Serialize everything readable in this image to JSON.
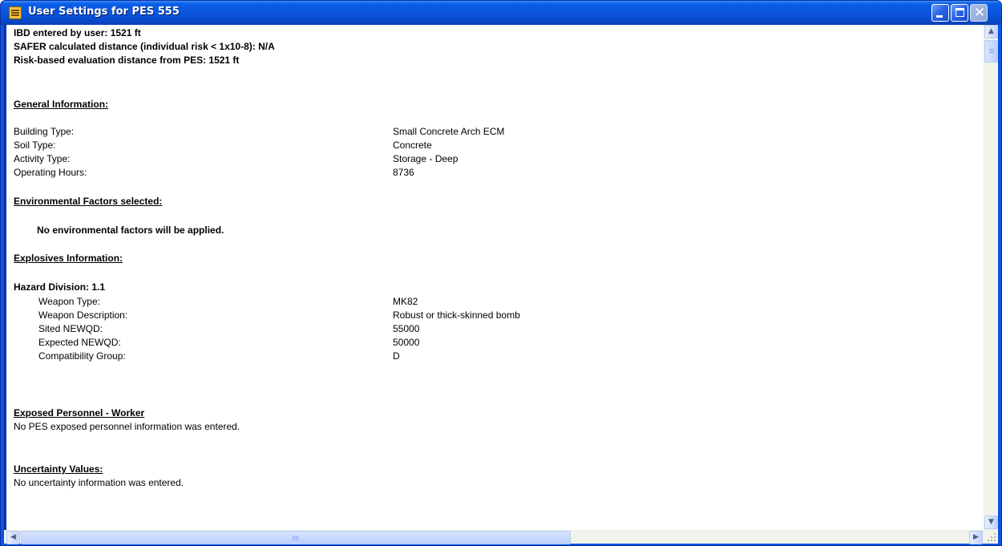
{
  "window": {
    "title": "User Settings for PES 555",
    "icons": {
      "app": "document-list-icon",
      "minimize": "minimize-icon",
      "maximize": "maximize-icon",
      "close": "close-icon"
    }
  },
  "summary": {
    "ibd": "IBD entered by user: 1521 ft",
    "safer": "SAFER calculated distance (individual risk < 1x10-8): N/A",
    "risk": "Risk-based evaluation distance from PES: 1521 ft"
  },
  "general": {
    "heading": "General Information:",
    "rows": [
      {
        "label": "Building Type:",
        "value": "Small Concrete Arch ECM"
      },
      {
        "label": "Soil Type:",
        "value": "Concrete"
      },
      {
        "label": "Activity Type:",
        "value": "Storage - Deep"
      },
      {
        "label": "Operating Hours:",
        "value": "8736"
      }
    ]
  },
  "environmental": {
    "heading": "Environmental Factors selected:",
    "note": "No environmental factors will be applied."
  },
  "explosives": {
    "heading": "Explosives Information:",
    "hazard_division": "Hazard Division: 1.1",
    "rows": [
      {
        "label": "Weapon Type:",
        "value": "MK82"
      },
      {
        "label": "Weapon Description:",
        "value": "Robust or thick-skinned bomb"
      },
      {
        "label": "Sited NEWQD:",
        "value": "55000"
      },
      {
        "label": "Expected NEWQD:",
        "value": "50000"
      },
      {
        "label": "Compatibility Group:",
        "value": "D"
      }
    ]
  },
  "personnel": {
    "heading": "Exposed Personnel - Worker",
    "note": "No PES exposed personnel information was entered."
  },
  "uncertainty": {
    "heading": "Uncertainty Values:",
    "note": "No uncertainty information was entered."
  },
  "scrollbars": {
    "vertical_position": 0.02,
    "horizontal_position": 0.0,
    "icons": {
      "up": "arrow-up-icon",
      "down": "arrow-down-icon",
      "left": "arrow-left-icon",
      "right": "arrow-right-icon"
    }
  }
}
